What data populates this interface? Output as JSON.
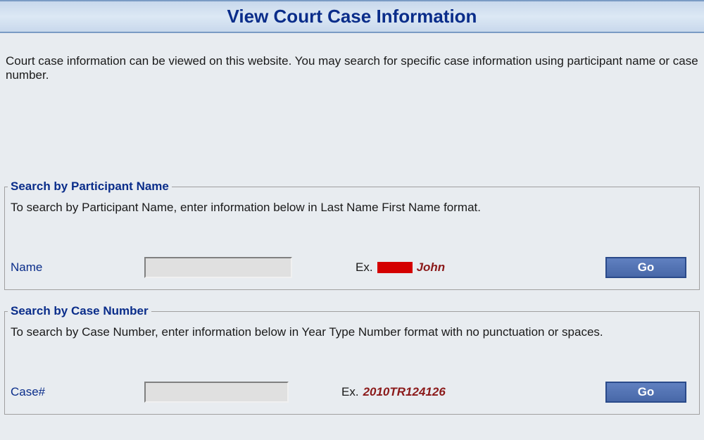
{
  "header": {
    "title": "View Court Case Information"
  },
  "intro": "Court case information can be viewed on this website. You may search for specific case information using participant name or case number.",
  "searchName": {
    "legend": "Search by Participant Name",
    "instruction": "To search by Participant Name, enter information below in Last Name First Name format.",
    "label": "Name",
    "value": "",
    "examplePrefix": "Ex.",
    "exampleText": "John",
    "buttonLabel": "Go"
  },
  "searchCase": {
    "legend": "Search by Case Number",
    "instruction": "To search by Case Number, enter information below in Year Type Number format with no punctuation or spaces.",
    "label": "Case#",
    "value": "",
    "examplePrefix": "Ex.",
    "exampleText": "2010TR124126",
    "buttonLabel": "Go"
  }
}
